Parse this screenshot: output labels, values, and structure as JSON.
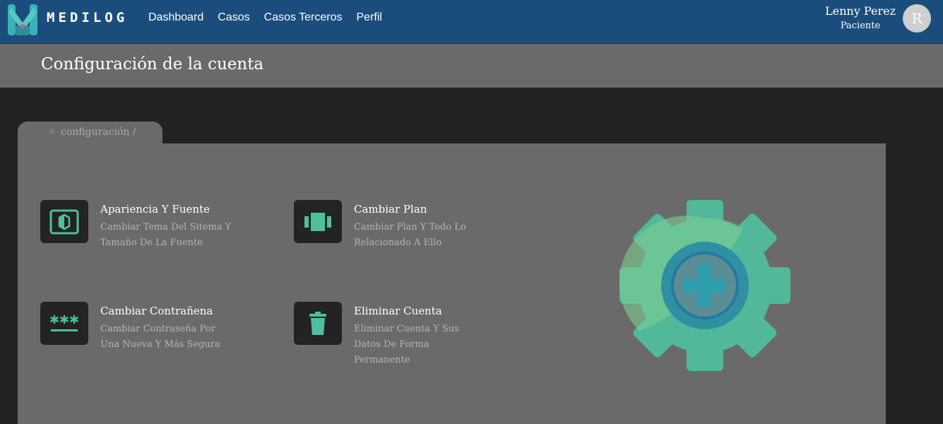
{
  "brand": {
    "name": "MEDILOG"
  },
  "nav": {
    "items": [
      "Dashboard",
      "Casos",
      "Casos Terceros",
      "Perfil"
    ]
  },
  "user": {
    "name": "Lenny Perez",
    "role": "Paciente",
    "initial": "R"
  },
  "page": {
    "title": "Configuración de la cuenta",
    "breadcrumb": "configuración /"
  },
  "options": [
    {
      "title": "Apariencia Y Fuente",
      "description": "Cambiar Tema Del Sitema Y Tamaño De La Fuente",
      "icon": "brightness-icon"
    },
    {
      "title": "Cambiar Plan",
      "description": "Cambiar Plan Y Todo Lo Relacionado A Ello",
      "icon": "carousel-icon"
    },
    {
      "title": "Cambiar Contrañena",
      "description": "Cambiar Contraseña Por Una Nueva Y Más Segura",
      "icon": "password-icon"
    },
    {
      "title": "Eliminar Cuenta",
      "description": "Eliminar Cuenta Y Sus Datos De Forma Permanente",
      "icon": "trash-icon"
    }
  ],
  "colors": {
    "navbar": "#1b4d7c",
    "accent": "#4fbf9f",
    "panel": "#6a6a6a",
    "background": "#222222"
  }
}
